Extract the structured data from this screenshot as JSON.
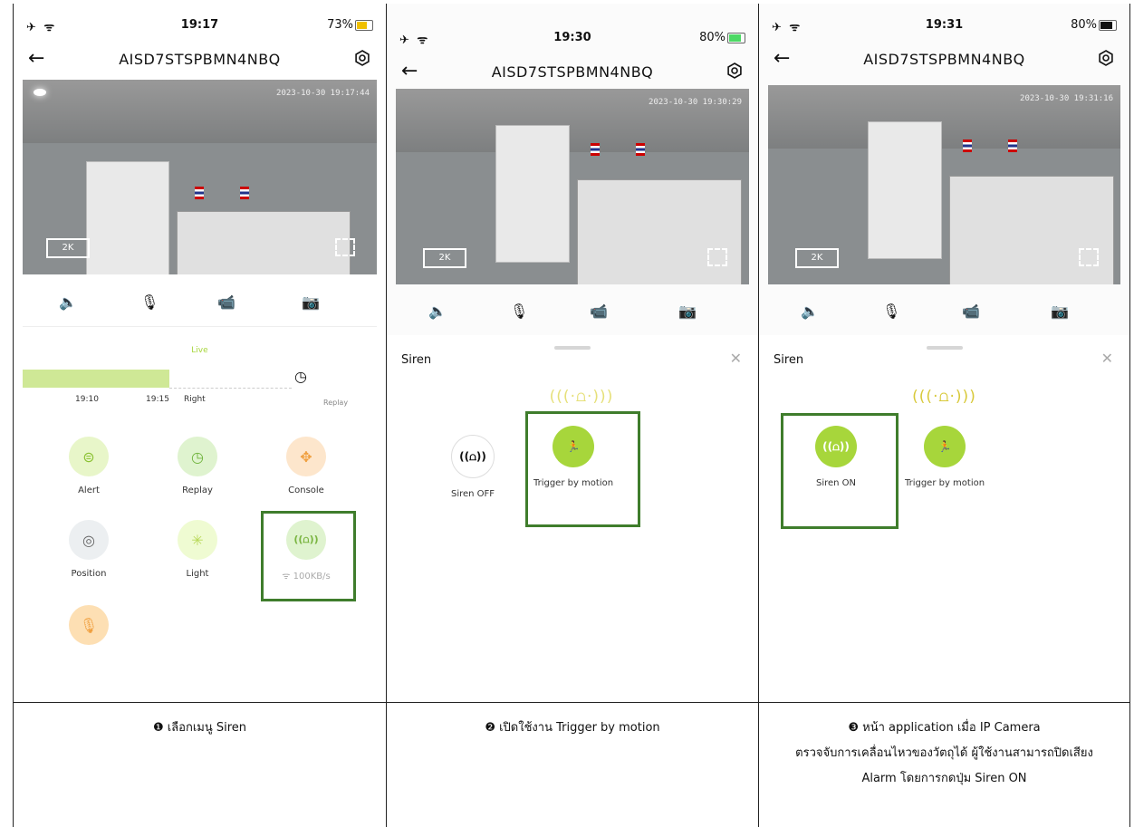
{
  "panels": [
    {
      "status": {
        "time": "19:17",
        "battery": "73%"
      },
      "title": "AISD7STSPBMN4NBQ",
      "timestamp": "2023-10-30 19:17:44",
      "quality": "2K"
    },
    {
      "status": {
        "time": "19:30",
        "battery": "80%"
      },
      "title": "AISD7STSPBMN4NBQ",
      "timestamp": "2023-10-30 19:30:29",
      "quality": "2K"
    },
    {
      "status": {
        "time": "19:31",
        "battery": "80%"
      },
      "title": "AISD7STSPBMN4NBQ",
      "timestamp": "2023-10-30 19:31:16",
      "quality": "2K"
    }
  ],
  "timeline": {
    "live": "Live",
    "t1": "19:10",
    "t2": "19:15",
    "right": "Right",
    "replay": "Replay"
  },
  "menu": {
    "alert": "Alert",
    "replay": "Replay",
    "console": "Console",
    "position": "Position",
    "light": "Light",
    "speed": "100KB/s"
  },
  "siren": {
    "title": "Siren",
    "off": "Siren OFF",
    "on": "Siren ON",
    "motion": "Trigger by motion"
  },
  "captions": {
    "c1": "❶ เลือกเมนู Siren",
    "c2": "❷ เปิดใช้งาน Trigger by motion",
    "c3_l1": "❸ หน้า application เมื่อ IP Camera",
    "c3_l2": "ตรวจจับการเคลื่อนไหวของวัตถุได้ ผู้ใช้งานสามารถปิดเสียง",
    "c3_l3": "Alarm โดยการกดปุ่ม Siren ON"
  },
  "colors": {
    "highlight": "#3f7d2c",
    "green": "#a7d63b",
    "lightgreen": "#e8f6c9"
  }
}
